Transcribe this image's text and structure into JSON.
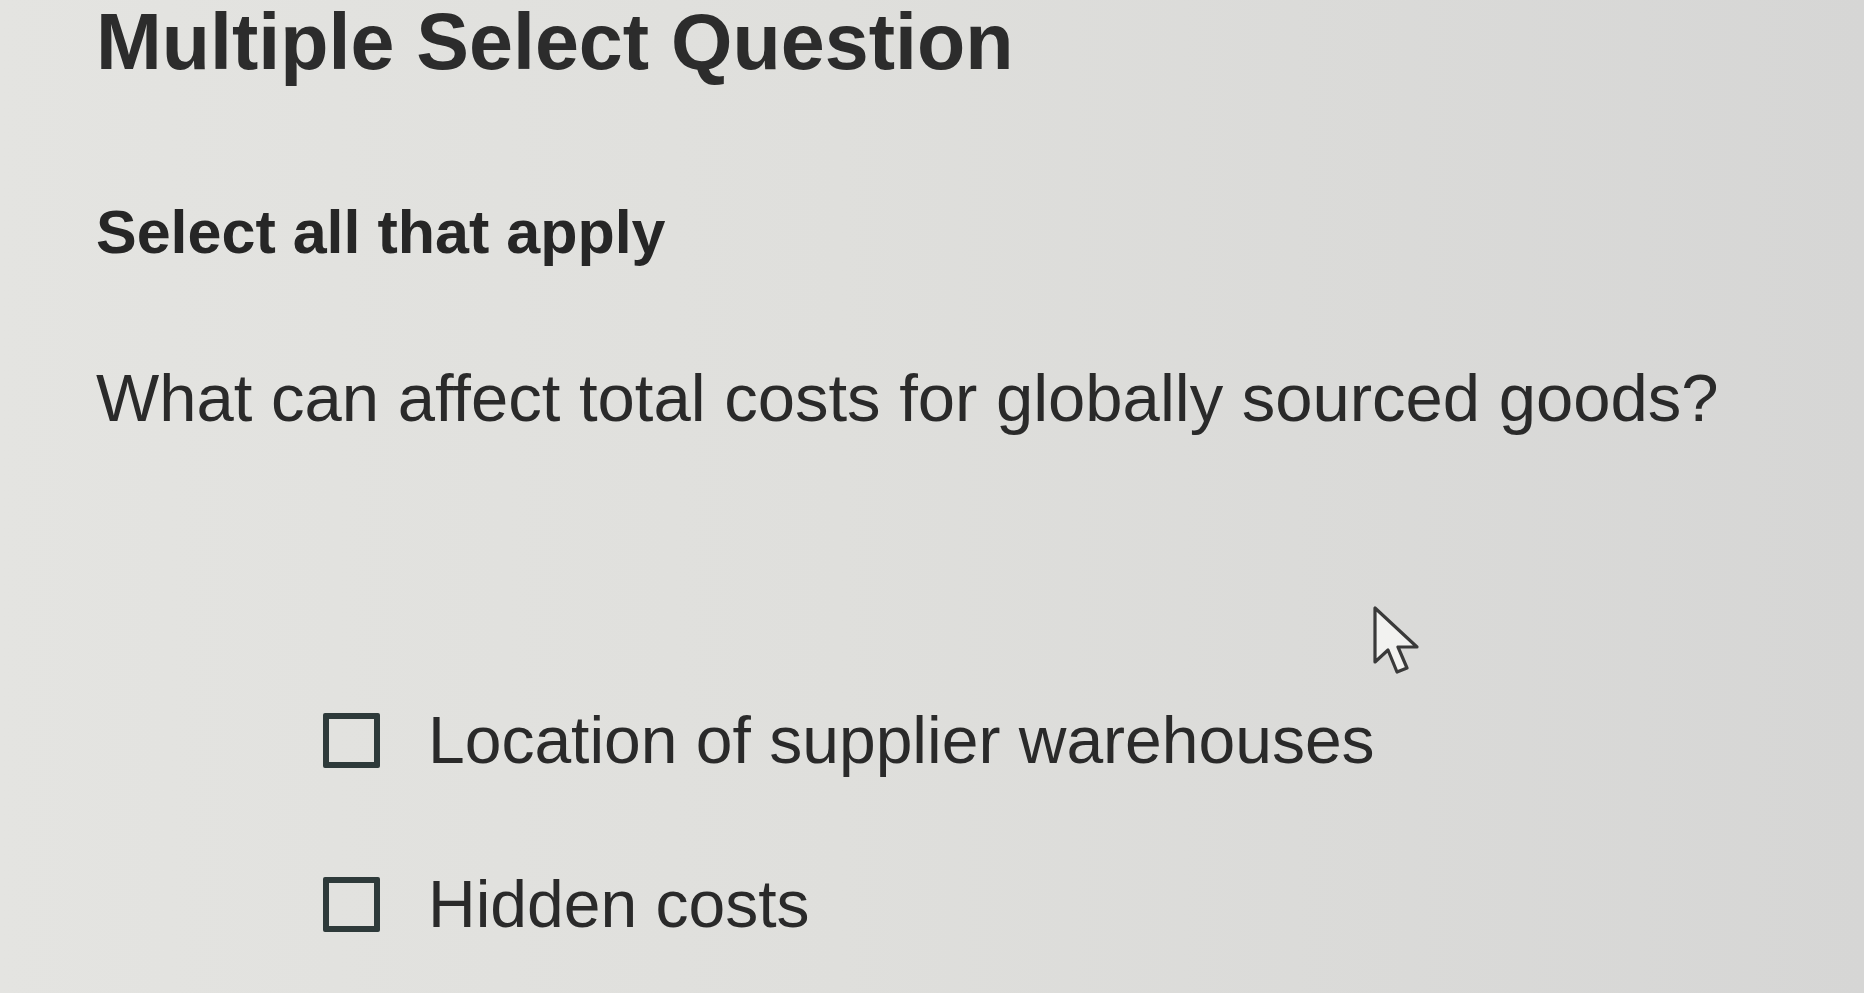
{
  "header": {
    "title": "Multiple Select Question"
  },
  "instruction": "Select all that apply",
  "question": "What can affect total costs for globally sourced goods?",
  "options": [
    {
      "label": "Location of supplier warehouses",
      "checked": false
    },
    {
      "label": "Hidden costs",
      "checked": false
    }
  ]
}
